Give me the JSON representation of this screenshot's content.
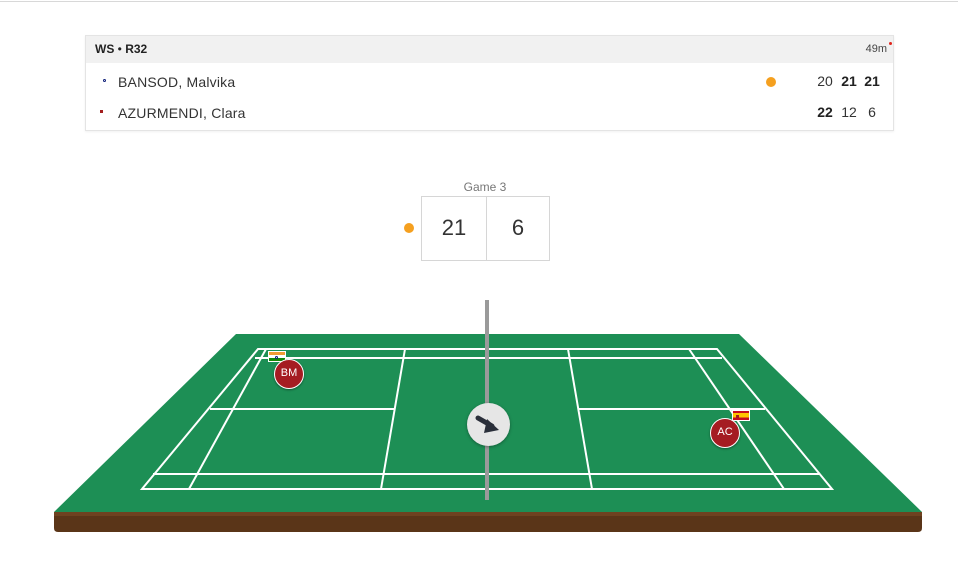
{
  "header": {
    "event": "WS",
    "round": "R32",
    "duration": "49m"
  },
  "players": [
    {
      "name": "BANSOD, Malvika",
      "country_flag": "india-flag-icon",
      "initials": "BM",
      "serving": true,
      "games": [
        "20",
        "21",
        "21"
      ],
      "won": [
        false,
        true,
        true
      ]
    },
    {
      "name": "AZURMENDI, Clara",
      "country_flag": "spain-flag-icon",
      "initials": "AC",
      "serving": false,
      "games": [
        "22",
        "12",
        "6"
      ],
      "won": [
        true,
        false,
        false
      ]
    }
  ],
  "live": {
    "game_label": "Game 3",
    "score_left": "21",
    "score_right": "6"
  },
  "colors": {
    "court_green": "#1d8f55",
    "court_edge": "#168049",
    "court_base": "#5a3518",
    "serve_indicator": "#f5a01f",
    "player_chip": "#a51c22",
    "live_dot": "#e0241b"
  },
  "icons": {
    "shuttle_direction": "arrow-down-right-icon"
  }
}
